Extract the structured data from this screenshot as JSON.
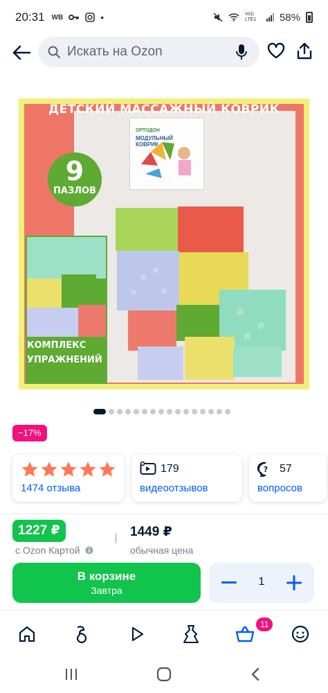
{
  "status_bar": {
    "time": "20:31",
    "carrier_badge": "WB",
    "battery": "58%",
    "network": "Vo)) LTE1"
  },
  "header": {
    "search_placeholder": "Искать на Ozon",
    "icons": {
      "back": "arrow-left-icon",
      "search": "search-icon",
      "mic": "microphone-icon",
      "favorite": "heart-icon",
      "share": "share-icon"
    }
  },
  "product_image": {
    "title": "ДЕТСКИЙ МАССАЖНЫЙ КОВРИК",
    "badge_number": "9",
    "badge_word": "ПАЗЛОВ",
    "inset_line1": "КОМПЛЕКС",
    "inset_line2": "УПРАЖНЕНИЙ",
    "box_brand": "ОРТОДОН",
    "box_name_line1": "МОДУЛЬНЫЙ",
    "box_name_line2": "КОВРИК",
    "gallery_count": 16,
    "gallery_active": 1
  },
  "discount": "−17%",
  "stats": {
    "rating_stars": 5,
    "reviews_label": "1474 отзыва",
    "video_count": "179",
    "video_label": "видеоотзывов",
    "questions_count": "57",
    "questions_label": "вопросов"
  },
  "price": {
    "ozon_card_price": "1227 ₽",
    "ozon_card_label": "с Ozon Картой",
    "regular_price": "1449 ₽",
    "regular_label": "обычная цена"
  },
  "cart": {
    "button_title": "В корзине",
    "button_subtitle": "Завтра",
    "quantity": "1"
  },
  "tabbar": {
    "items": [
      "home-icon",
      "fresh-icon",
      "play-icon",
      "dress-icon",
      "cart-icon",
      "profile-icon"
    ],
    "cart_badge": "11"
  },
  "colors": {
    "accent_blue": "#005bff",
    "green": "#10c44c",
    "pink": "#f1117e",
    "star": "#ff7855"
  }
}
